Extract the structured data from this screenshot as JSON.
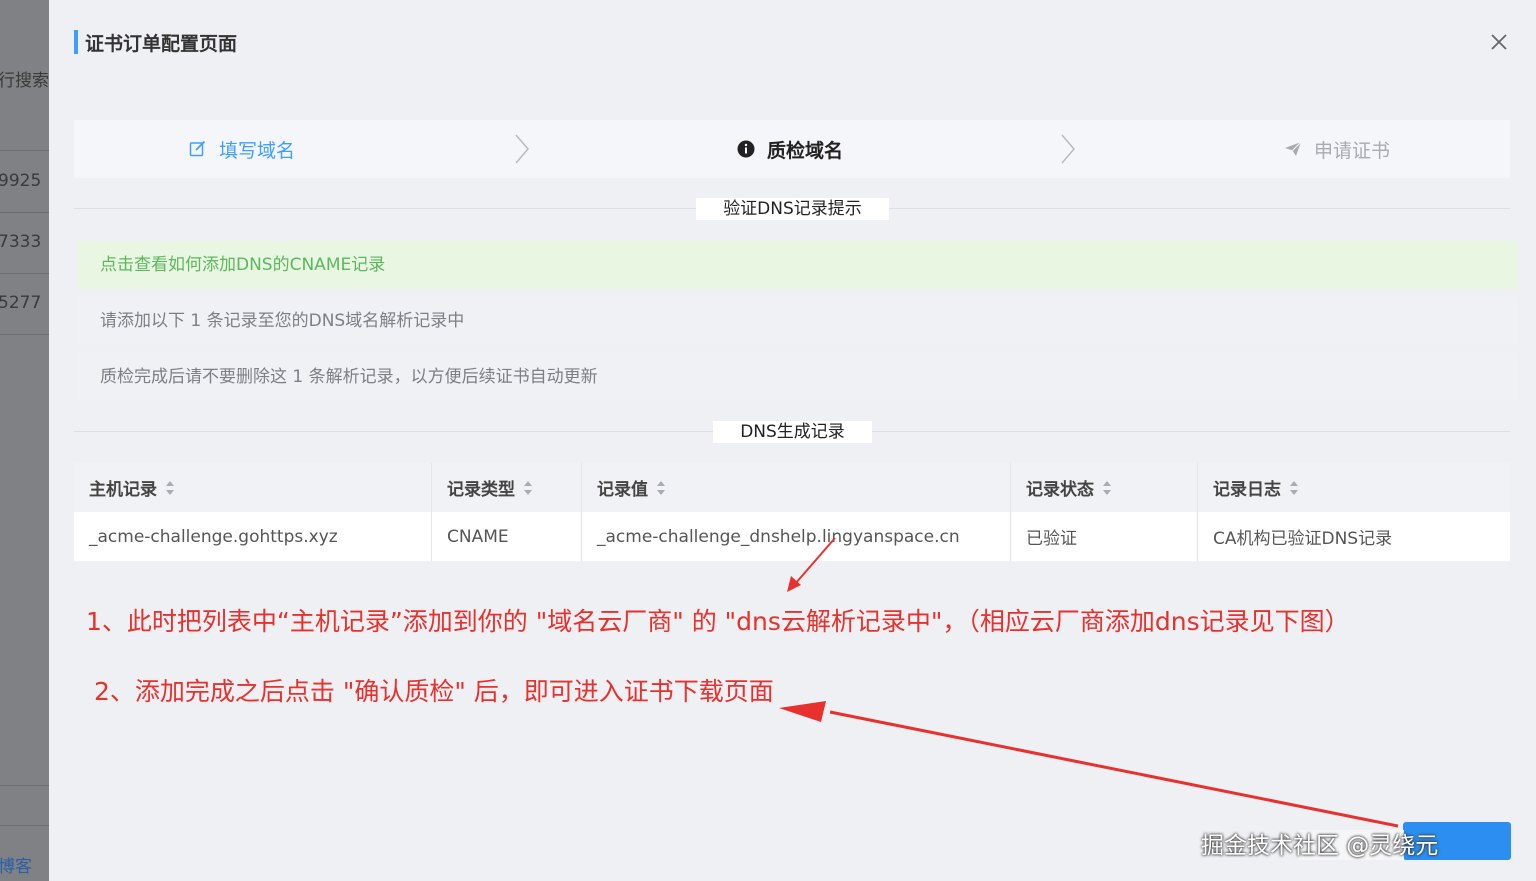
{
  "background": {
    "texts": [
      "行搜索",
      "9925",
      "7333",
      "5277",
      "博客"
    ]
  },
  "drawer": {
    "title": "证书订单配置页面"
  },
  "steps": [
    {
      "label": "填写域名",
      "icon": "edit-icon",
      "state": "done"
    },
    {
      "label": "质检域名",
      "icon": "info-icon",
      "state": "active"
    },
    {
      "label": "申请证书",
      "icon": "send-icon",
      "state": "pending"
    }
  ],
  "section_verify": {
    "label": "验证DNS记录提示"
  },
  "tips": {
    "link": "点击查看如何添加DNS的CNAME记录",
    "line1": "请添加以下 1 条记录至您的DNS域名解析记录中",
    "line2": "质检完成后请不要删除这 1 条解析记录，以方便后续证书自动更新"
  },
  "section_dns": {
    "label": "DNS生成记录"
  },
  "table": {
    "headers": [
      "主机记录",
      "记录类型",
      "记录值",
      "记录状态",
      "记录日志"
    ],
    "rows": [
      [
        "_acme-challenge.gohttps.xyz",
        "CNAME",
        "_acme-challenge_dnshelp.lingyanspace.cn",
        "已验证",
        "CA机构已验证DNS记录"
      ]
    ]
  },
  "annotations": {
    "step1": "1、此时把列表中“主机记录”添加到你的 \"域名云厂商\" 的 \"dns云解析记录中\"，（相应云厂商添加dns记录见下图）",
    "step2": "2、添加完成之后点击 \"确认质检\" 后，即可进入证书下载页面"
  },
  "watermark": "掘金技术社区 @灵绕元",
  "colors": {
    "primary": "#409eff",
    "success": "#5cb85c",
    "annotation": "#e8302c"
  }
}
